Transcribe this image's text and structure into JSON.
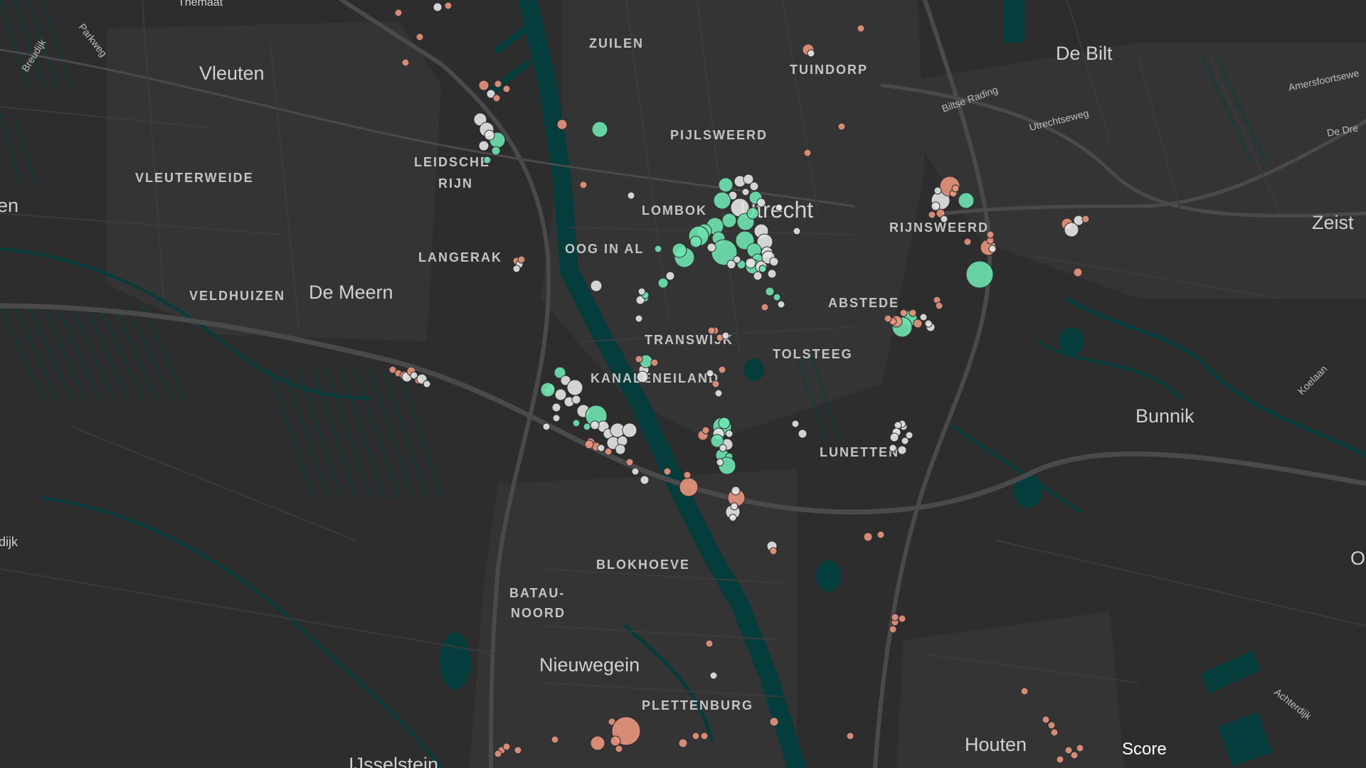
{
  "map": {
    "colors": {
      "background": "#2d2d2e",
      "water": "#053c3c",
      "road_major": "#4a4a4b",
      "road_minor": "#3b3b3c",
      "score_low": "#e8957c",
      "score_mid": "#e6e6e6",
      "score_high": "#6ee3b0"
    },
    "places": {
      "thematic": "Themaat",
      "vleuten": "Vleuten",
      "vleuterweide": "VLEUTERWEIDE",
      "en": "en",
      "zuilen": "ZUILEN",
      "tuindorp": "TUINDORP",
      "de_bilt": "De Bilt",
      "pijlsweerd": "PIJLSWEERD",
      "leidsche": "LEIDSCHE",
      "rijn": "RIJN",
      "lombok": "LOMBOK",
      "utrecht": "Utrecht",
      "rijnsweerd": "RIJNSWEERD",
      "zeist": "Zeist",
      "oog_in_al": "OOG IN AL",
      "langerak": "LANGERAK",
      "veldhuizen": "VELDHUIZEN",
      "de_meern": "De Meern",
      "abstede": "ABSTEDE",
      "transwijk": "TRANSWIJK",
      "tolsteeg": "TOLSTEEG",
      "kanaleneiland": "KANALENEILAND",
      "bunnik": "Bunnik",
      "lunetten": "LUNETTEN",
      "blokhoeve": "BLOKHOEVE",
      "batau": "BATAU-",
      "noord": "NOORD",
      "nieuwegein": "Nieuwegein",
      "plettenburg": "PLETTENBURG",
      "houten": "Houten",
      "ijsselstein": "IJsselstein",
      "dijk": "dijk",
      "o": "O"
    },
    "roads": {
      "breudijk": "Breudijk",
      "parkweg": "Parkweg",
      "biltse_rading": "Biltse Rading",
      "utrechtseweg": "Utrechtseweg",
      "amersfoortseweg": "Amersfoortsewe",
      "de_dreef": "De Dre",
      "koelaan": "Koelaan",
      "achterdijk": "Achterdijk"
    },
    "legend": {
      "title": "Score"
    },
    "points": [
      [
        560,
        18,
        5,
        "low"
      ],
      [
        615,
        10,
        6,
        "mid"
      ],
      [
        630,
        8,
        5,
        "low"
      ],
      [
        590,
        52,
        5,
        "low"
      ],
      [
        570,
        88,
        5,
        "low"
      ],
      [
        680,
        120,
        7,
        "low"
      ],
      [
        700,
        118,
        5,
        "low"
      ],
      [
        690,
        132,
        6,
        "mid"
      ],
      [
        712,
        125,
        5,
        "low"
      ],
      [
        698,
        138,
        5,
        "low"
      ],
      [
        675,
        168,
        9,
        "mid"
      ],
      [
        684,
        182,
        10,
        "mid"
      ],
      [
        699,
        197,
        11,
        "high"
      ],
      [
        688,
        190,
        7,
        "mid"
      ],
      [
        680,
        205,
        7,
        "mid"
      ],
      [
        697,
        212,
        6,
        "high"
      ],
      [
        685,
        225,
        5,
        "high"
      ],
      [
        790,
        175,
        7,
        "low"
      ],
      [
        843,
        182,
        11,
        "high"
      ],
      [
        820,
        260,
        5,
        "low"
      ],
      [
        887,
        275,
        5,
        "mid"
      ],
      [
        1136,
        70,
        8,
        "low"
      ],
      [
        1140,
        75,
        5,
        "mid"
      ],
      [
        1210,
        40,
        5,
        "low"
      ],
      [
        1183,
        178,
        5,
        "low"
      ],
      [
        1135,
        215,
        5,
        "low"
      ],
      [
        1020,
        260,
        10,
        "high"
      ],
      [
        1040,
        255,
        8,
        "mid"
      ],
      [
        1052,
        252,
        7,
        "mid"
      ],
      [
        1060,
        262,
        6,
        "mid"
      ],
      [
        1030,
        275,
        6,
        "mid"
      ],
      [
        1048,
        270,
        5,
        "mid"
      ],
      [
        1062,
        278,
        9,
        "high"
      ],
      [
        1015,
        282,
        12,
        "high"
      ],
      [
        1040,
        292,
        13,
        "mid"
      ],
      [
        1070,
        285,
        6,
        "mid"
      ],
      [
        1095,
        292,
        5,
        "mid"
      ],
      [
        1120,
        325,
        5,
        "mid"
      ],
      [
        1025,
        310,
        10,
        "high"
      ],
      [
        1048,
        312,
        12,
        "high"
      ],
      [
        1058,
        300,
        8,
        "high"
      ],
      [
        1005,
        318,
        12,
        "high"
      ],
      [
        990,
        325,
        10,
        "high"
      ],
      [
        982,
        332,
        14,
        "high"
      ],
      [
        1010,
        335,
        9,
        "high"
      ],
      [
        1047,
        338,
        13,
        "high"
      ],
      [
        1070,
        325,
        10,
        "mid"
      ],
      [
        1075,
        340,
        11,
        "mid"
      ],
      [
        1018,
        355,
        18,
        "high"
      ],
      [
        1060,
        352,
        10,
        "high"
      ],
      [
        1078,
        355,
        8,
        "mid"
      ],
      [
        1065,
        365,
        8,
        "high"
      ],
      [
        1028,
        372,
        6,
        "mid"
      ],
      [
        1058,
        375,
        10,
        "high"
      ],
      [
        1070,
        375,
        8,
        "mid"
      ],
      [
        1080,
        362,
        9,
        "mid"
      ],
      [
        962,
        362,
        14,
        "high"
      ],
      [
        955,
        352,
        10,
        "high"
      ],
      [
        978,
        340,
        8,
        "high"
      ],
      [
        1000,
        348,
        6,
        "mid"
      ],
      [
        1072,
        378,
        5,
        "high"
      ],
      [
        1085,
        385,
        6,
        "mid"
      ],
      [
        1088,
        368,
        6,
        "mid"
      ],
      [
        1065,
        388,
        6,
        "mid"
      ],
      [
        1055,
        370,
        7,
        "mid"
      ],
      [
        1042,
        372,
        6,
        "high"
      ],
      [
        1036,
        365,
        5,
        "mid"
      ],
      [
        942,
        388,
        6,
        "mid"
      ],
      [
        932,
        398,
        7,
        "high"
      ],
      [
        925,
        350,
        5,
        "high"
      ],
      [
        905,
        418,
        7,
        "high"
      ],
      [
        900,
        422,
        6,
        "mid"
      ],
      [
        838,
        402,
        8,
        "mid"
      ],
      [
        898,
        448,
        5,
        "mid"
      ],
      [
        1082,
        410,
        6,
        "high"
      ],
      [
        1092,
        418,
        5,
        "high"
      ],
      [
        1098,
        428,
        5,
        "mid"
      ],
      [
        1075,
        432,
        5,
        "low"
      ],
      [
        1322,
        282,
        13,
        "mid"
      ],
      [
        1358,
        282,
        11,
        "high"
      ],
      [
        1335,
        262,
        14,
        "low"
      ],
      [
        1315,
        290,
        6,
        "mid"
      ],
      [
        1322,
        300,
        6,
        "low"
      ],
      [
        1310,
        302,
        5,
        "low"
      ],
      [
        1327,
        308,
        5,
        "mid"
      ],
      [
        1340,
        272,
        5,
        "low"
      ],
      [
        1343,
        265,
        5,
        "low"
      ],
      [
        1318,
        268,
        5,
        "mid"
      ],
      [
        1389,
        348,
        11,
        "low"
      ],
      [
        1377,
        386,
        19,
        "high"
      ],
      [
        1392,
        338,
        5,
        "low"
      ],
      [
        1395,
        350,
        5,
        "mid"
      ],
      [
        1500,
        315,
        8,
        "low"
      ],
      [
        1516,
        310,
        7,
        "mid"
      ],
      [
        1506,
        323,
        10,
        "mid"
      ],
      [
        1526,
        308,
        5,
        "low"
      ],
      [
        1515,
        383,
        6,
        "low"
      ],
      [
        1308,
        460,
        6,
        "mid"
      ],
      [
        1317,
        422,
        5,
        "low"
      ],
      [
        1320,
        430,
        5,
        "low"
      ],
      [
        1278,
        448,
        11,
        "high"
      ],
      [
        1268,
        460,
        14,
        "high"
      ],
      [
        1260,
        452,
        8,
        "low"
      ],
      [
        1283,
        440,
        5,
        "low"
      ],
      [
        1290,
        455,
        6,
        "low"
      ],
      [
        1298,
        446,
        5,
        "mid"
      ],
      [
        1255,
        452,
        5,
        "low"
      ],
      [
        1248,
        448,
        5,
        "low"
      ],
      [
        1392,
        330,
        5,
        "low"
      ],
      [
        1360,
        340,
        5,
        "low"
      ],
      [
        1255,
        630,
        5,
        "mid"
      ],
      [
        1260,
        606,
        5,
        "low"
      ],
      [
        1272,
        620,
        5,
        "mid"
      ],
      [
        1278,
        612,
        5,
        "mid"
      ],
      [
        1268,
        633,
        6,
        "mid"
      ],
      [
        1005,
        465,
        5,
        "low"
      ],
      [
        1012,
        475,
        5,
        "low"
      ],
      [
        1020,
        472,
        5,
        "mid"
      ],
      [
        1015,
        520,
        5,
        "low"
      ],
      [
        998,
        525,
        5,
        "mid"
      ],
      [
        1000,
        465,
        5,
        "low"
      ],
      [
        1015,
        600,
        13,
        "high"
      ],
      [
        1010,
        610,
        8,
        "mid"
      ],
      [
        1022,
        625,
        8,
        "mid"
      ],
      [
        1008,
        620,
        9,
        "high"
      ],
      [
        1015,
        640,
        9,
        "high"
      ],
      [
        1025,
        642,
        5,
        "high"
      ],
      [
        1018,
        595,
        8,
        "high"
      ],
      [
        1025,
        610,
        5,
        "mid"
      ],
      [
        1016,
        630,
        5,
        "mid"
      ],
      [
        1022,
        655,
        12,
        "high"
      ],
      [
        1012,
        650,
        5,
        "mid"
      ],
      [
        968,
        685,
        13,
        "low"
      ],
      [
        1035,
        700,
        12,
        "low"
      ],
      [
        1030,
        720,
        10,
        "mid"
      ],
      [
        1032,
        712,
        5,
        "mid"
      ],
      [
        1030,
        728,
        5,
        "mid"
      ],
      [
        988,
        612,
        7,
        "low"
      ],
      [
        992,
        605,
        5,
        "low"
      ],
      [
        1085,
        768,
        7,
        "mid"
      ],
      [
        1087,
        775,
        5,
        "low"
      ],
      [
        885,
        650,
        5,
        "low"
      ],
      [
        893,
        663,
        5,
        "mid"
      ],
      [
        906,
        675,
        6,
        "mid"
      ],
      [
        938,
        663,
        5,
        "low"
      ],
      [
        905,
        520,
        7,
        "mid"
      ],
      [
        908,
        508,
        9,
        "high"
      ],
      [
        903,
        530,
        8,
        "mid"
      ],
      [
        898,
        505,
        5,
        "low"
      ],
      [
        920,
        510,
        5,
        "low"
      ],
      [
        830,
        622,
        6,
        "low"
      ],
      [
        838,
        628,
        6,
        "low"
      ],
      [
        1006,
        540,
        5,
        "low"
      ],
      [
        1010,
        553,
        5,
        "mid"
      ],
      [
        775,
        545,
        5,
        "mid"
      ],
      [
        770,
        550,
        5,
        "low"
      ],
      [
        552,
        520,
        5,
        "low"
      ],
      [
        560,
        525,
        5,
        "low"
      ],
      [
        568,
        528,
        6,
        "low"
      ],
      [
        572,
        530,
        7,
        "mid"
      ],
      [
        578,
        522,
        6,
        "low"
      ],
      [
        582,
        528,
        5,
        "mid"
      ],
      [
        588,
        535,
        5,
        "low"
      ],
      [
        593,
        533,
        7,
        "mid"
      ],
      [
        600,
        540,
        5,
        "mid"
      ],
      [
        726,
        367,
        5,
        "low"
      ],
      [
        730,
        372,
        5,
        "mid"
      ],
      [
        733,
        365,
        5,
        "low"
      ],
      [
        726,
        378,
        5,
        "mid"
      ],
      [
        907,
        415,
        5,
        "high"
      ],
      [
        902,
        410,
        5,
        "mid"
      ],
      [
        770,
        548,
        10,
        "high"
      ],
      [
        787,
        524,
        8,
        "high"
      ],
      [
        795,
        535,
        7,
        "mid"
      ],
      [
        788,
        555,
        8,
        "mid"
      ],
      [
        808,
        545,
        11,
        "mid"
      ],
      [
        800,
        565,
        7,
        "mid"
      ],
      [
        782,
        573,
        6,
        "mid"
      ],
      [
        810,
        562,
        6,
        "mid"
      ],
      [
        782,
        588,
        5,
        "mid"
      ],
      [
        820,
        578,
        9,
        "mid"
      ],
      [
        838,
        585,
        15,
        "high"
      ],
      [
        848,
        600,
        8,
        "mid"
      ],
      [
        855,
        610,
        7,
        "mid"
      ],
      [
        868,
        605,
        10,
        "mid"
      ],
      [
        862,
        623,
        9,
        "mid"
      ],
      [
        875,
        620,
        7,
        "mid"
      ],
      [
        885,
        605,
        10,
        "mid"
      ],
      [
        872,
        632,
        7,
        "mid"
      ],
      [
        855,
        635,
        5,
        "low"
      ],
      [
        845,
        630,
        5,
        "mid"
      ],
      [
        828,
        625,
        6,
        "low"
      ],
      [
        810,
        595,
        5,
        "high"
      ],
      [
        825,
        600,
        5,
        "high"
      ],
      [
        836,
        598,
        6,
        "mid"
      ],
      [
        768,
        600,
        5,
        "mid"
      ],
      [
        1118,
        596,
        5,
        "mid"
      ],
      [
        1128,
        610,
        6,
        "mid"
      ],
      [
        1270,
        600,
        5,
        "mid"
      ],
      [
        1268,
        596,
        5,
        "mid"
      ],
      [
        1262,
        598,
        5,
        "mid"
      ],
      [
        966,
        668,
        5,
        "low"
      ],
      [
        1034,
        690,
        6,
        "mid"
      ],
      [
        1260,
        608,
        6,
        "mid"
      ],
      [
        1257,
        615,
        6,
        "mid"
      ],
      [
        1270,
        440,
        5,
        "low"
      ],
      [
        1305,
        455,
        5,
        "mid"
      ],
      [
        1258,
        875,
        5,
        "low"
      ],
      [
        1268,
        870,
        5,
        "low"
      ],
      [
        1255,
        885,
        5,
        "low"
      ],
      [
        1220,
        755,
        6,
        "low"
      ],
      [
        1238,
        752,
        5,
        "low"
      ],
      [
        997,
        905,
        5,
        "low"
      ],
      [
        1003,
        950,
        5,
        "mid"
      ],
      [
        1088,
        1015,
        6,
        "low"
      ],
      [
        860,
        1015,
        5,
        "low"
      ],
      [
        880,
        1028,
        20,
        "low"
      ],
      [
        865,
        1042,
        7,
        "low"
      ],
      [
        870,
        1053,
        5,
        "low"
      ],
      [
        840,
        1045,
        10,
        "low"
      ],
      [
        780,
        1040,
        5,
        "low"
      ],
      [
        960,
        1045,
        6,
        "low"
      ],
      [
        978,
        1035,
        5,
        "low"
      ],
      [
        705,
        1055,
        5,
        "low"
      ],
      [
        700,
        1060,
        5,
        "low"
      ],
      [
        712,
        1050,
        5,
        "low"
      ],
      [
        728,
        1055,
        5,
        "low"
      ],
      [
        990,
        1035,
        5,
        "low"
      ],
      [
        1195,
        1035,
        5,
        "low"
      ],
      [
        1470,
        1012,
        5,
        "low"
      ],
      [
        1478,
        1020,
        5,
        "low"
      ],
      [
        1482,
        1030,
        5,
        "low"
      ],
      [
        1502,
        1055,
        5,
        "low"
      ],
      [
        1510,
        1062,
        5,
        "low"
      ],
      [
        1490,
        1068,
        5,
        "low"
      ],
      [
        1518,
        1052,
        5,
        "low"
      ],
      [
        1440,
        972,
        5,
        "low"
      ],
      [
        1258,
        868,
        5,
        "low"
      ]
    ]
  }
}
